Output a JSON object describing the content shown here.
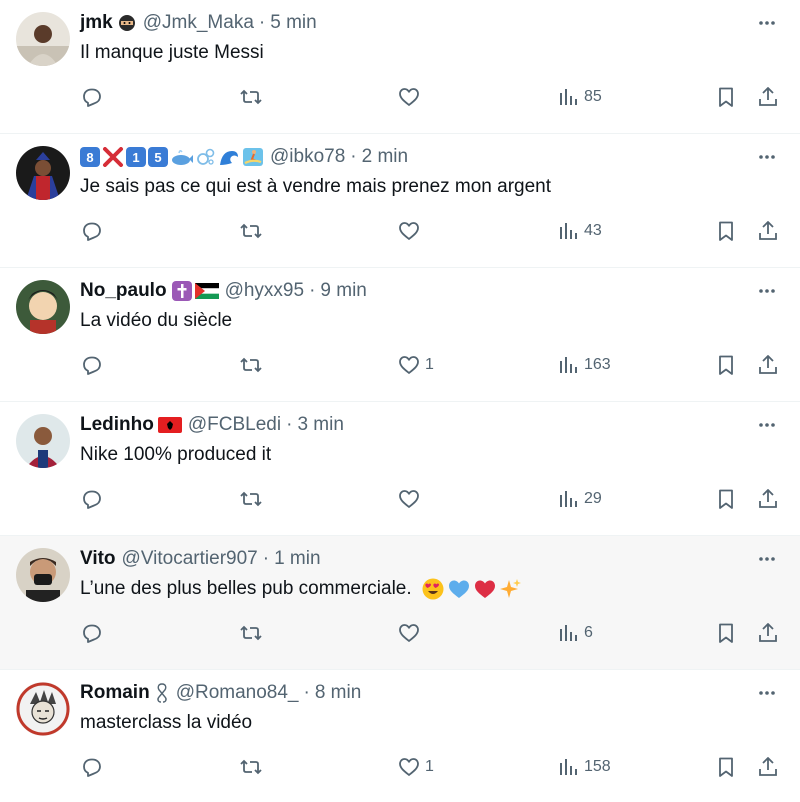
{
  "tweets": [
    {
      "name": "jmk",
      "handle": "@Jmk_Maka",
      "time": "5 min",
      "text": "Il manque juste Messi",
      "emoji_after_name": [
        "ninja-emoji"
      ],
      "likes": "",
      "views": "85",
      "hover": false
    },
    {
      "name": "",
      "name_emojis": [
        "keycap-8-emoji",
        "cross-mark-emoji",
        "keycap-1-emoji",
        "keycap-5-emoji",
        "whale-emoji",
        "bubbles-emoji",
        "wave-emoji",
        "surfer-emoji"
      ],
      "name_keycaps": {
        "k8": "8",
        "k1": "1",
        "k5": "5"
      },
      "handle": "@ibko78",
      "time": "2 min",
      "text": "Je sais pas ce qui est à vendre mais prenez mon argent",
      "likes": "",
      "views": "43",
      "hover": false
    },
    {
      "name": "No_paulo",
      "emoji_after_name": [
        "latin-cross-emoji",
        "palestine-flag-emoji"
      ],
      "handle": "@hyxx95",
      "time": "9 min",
      "text": "La vidéo du siècle",
      "likes": "1",
      "views": "163",
      "hover": false
    },
    {
      "name": "Ledinho",
      "emoji_after_name": [
        "albania-flag-emoji"
      ],
      "handle": "@FCBLedi",
      "time": "3 min",
      "text": "Nike 100% produced it",
      "likes": "",
      "views": "29",
      "hover": false
    },
    {
      "name": "Vito",
      "handle": "@Vitocartier907",
      "time": "1 min",
      "text": "L’une des plus belles pub commerciale.",
      "text_emojis": [
        "heart-eyes-emoji",
        "blue-heart-emoji",
        "red-heart-emoji",
        "sparkles-emoji"
      ],
      "likes": "",
      "views": "6",
      "hover": true
    },
    {
      "name": "Romain",
      "emoji_after_name": [
        "ribbon-symbol"
      ],
      "handle": "@Romano84_",
      "time": "8 min",
      "text": "masterclass la vidéo",
      "likes": "1",
      "views": "158",
      "hover": false
    }
  ],
  "separator": "·",
  "colors": {
    "text_primary": "#0f1419",
    "text_secondary": "#536471",
    "divider": "#eff3f4",
    "hover_bg": "#f7f7f7"
  }
}
